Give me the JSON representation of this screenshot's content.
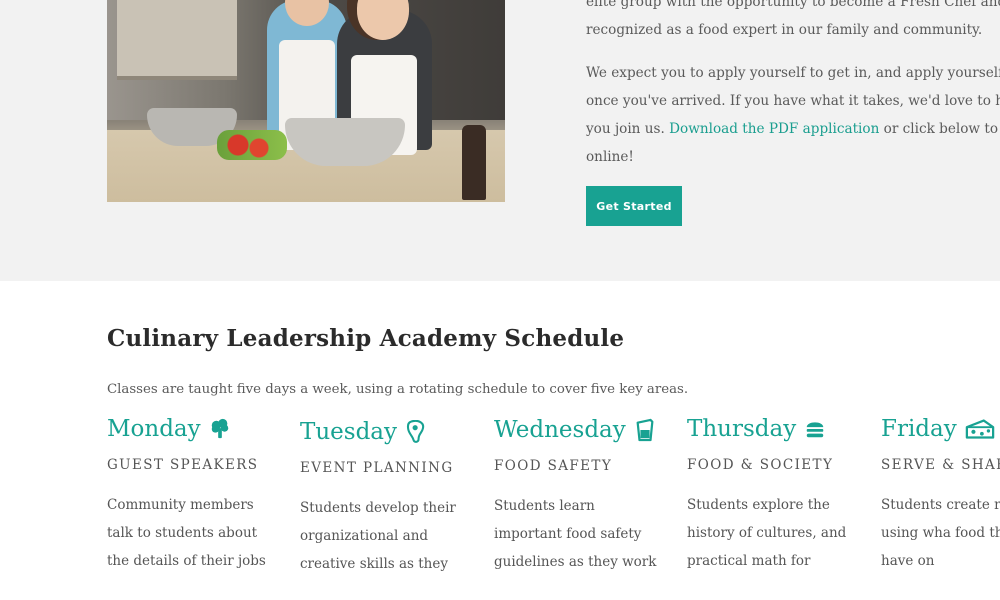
{
  "intro": {
    "line1": "elite group with the opportunity to become a Fresh Chef and b",
    "line2": "recognized as a food expert in our family and community.",
    "para2_line1": "We expect you to apply yourself to get in, and apply yourself",
    "para2_line2": "once you've arrived. If you have what it takes, we'd love to ha",
    "para2_line3_pre": "you join us. ",
    "para2_link": "Download the PDF application",
    "para2_line3_post": " or click below to a",
    "para2_line4": "online!",
    "button_label": "Get Started"
  },
  "schedule": {
    "title": "Culinary Leadership Academy Schedule",
    "subtitle": "Classes are taught five days a week, using a rotating schedule to cover five key areas.",
    "accent_color": "#18a292",
    "days": [
      {
        "name": "Monday",
        "icon": "broccoli-icon",
        "topic": "Guest Speakers",
        "text": "Community members talk to students about the details of their jobs"
      },
      {
        "name": "Tuesday",
        "icon": "steak-icon",
        "topic": "Event Planning",
        "text": "Students develop their organizational and creative skills as they"
      },
      {
        "name": "Wednesday",
        "icon": "drink-icon",
        "topic": "Food Safety",
        "text": "Students learn important food safety guidelines as they work"
      },
      {
        "name": "Thursday",
        "icon": "burger-icon",
        "topic": "Food & Society",
        "text": "Students explore the history of cultures, and practical math for"
      },
      {
        "name": "Friday",
        "icon": "cheese-icon",
        "topic": "Serve & Shar",
        "text": "Students create recipes using wha food they have on"
      }
    ]
  }
}
